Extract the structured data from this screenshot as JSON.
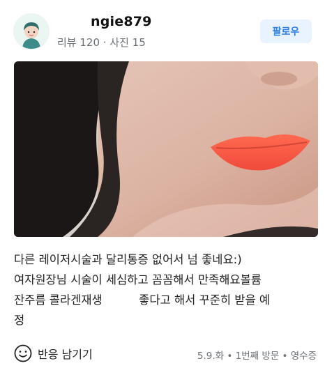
{
  "header": {
    "username": "ngie879",
    "meta": "리뷰 120 · 사진 15",
    "follow_label": "팔로우"
  },
  "review": {
    "text": "다른 레이저시술과 달리통증 없어서 넘 좋네요:)\n여자원장님 시술이 세심하고 꼼꼼해서 만족해요볼륨\n잔주름 콜라겐재생          좋다고 해서 꾸준히 받을 예\n정"
  },
  "footer": {
    "react_label": "반응 남기기",
    "visit_info": "5.9.화 • 1번째 방문 • 영수증"
  },
  "icons": {
    "avatar": "avatar-illustration",
    "react": "smile-icon"
  },
  "colors": {
    "accent": "#2c7ee8",
    "follow_bg": "#e8f3ff",
    "muted_text": "#6b7075"
  }
}
